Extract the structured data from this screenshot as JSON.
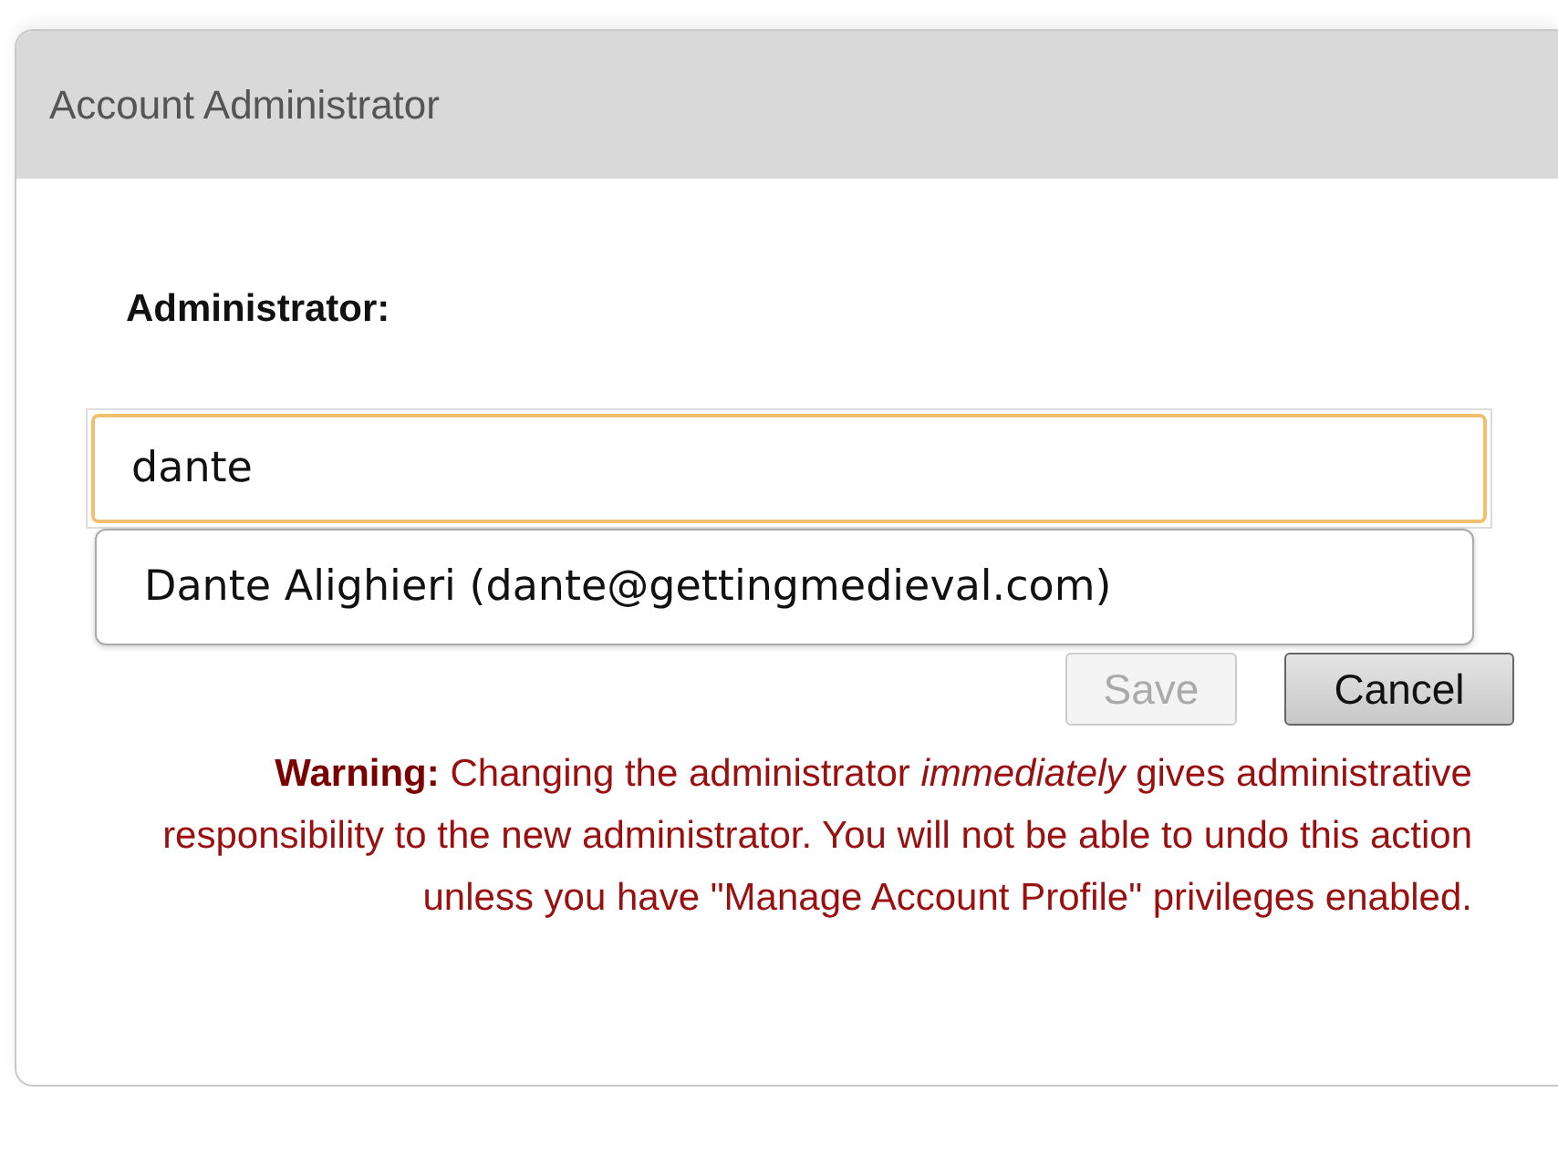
{
  "panel": {
    "title": "Account Administrator"
  },
  "field": {
    "label": "Administrator:",
    "value": "dante"
  },
  "suggestions": [
    {
      "label": "Dante Alighieri (dante@gettingmedieval.com)"
    }
  ],
  "buttons": [
    {
      "label": "Save",
      "disabled": true
    },
    {
      "label": "Cancel",
      "disabled": false
    }
  ],
  "warning": "**Warning:** Changing the administrator *immediately* gives administrative responsibility to the new administrator. You will not be able to undo this action unless you have \"Manage Account Profile\" privileges enabled."
}
